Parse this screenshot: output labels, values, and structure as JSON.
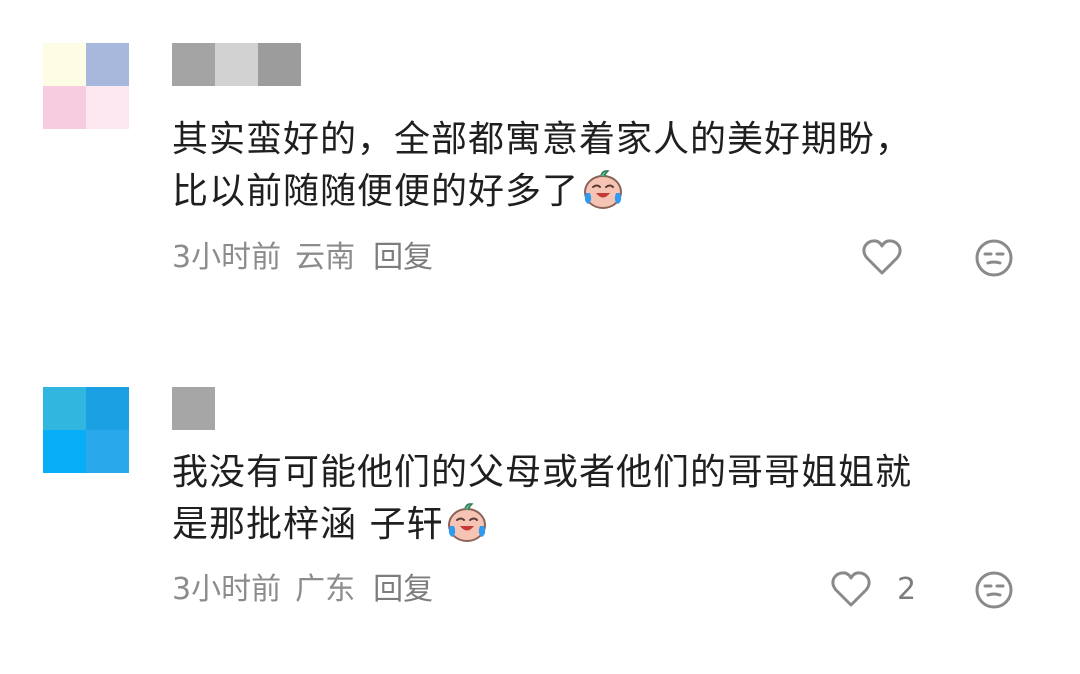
{
  "comments": [
    {
      "text_line1": "其实蛮好的，全部都寓意着家人的美好期盼，",
      "text_line2": "比以前随随便便的好多了",
      "emoji": "crying-laughing-emoji",
      "time": "3小时前",
      "location": "云南",
      "reply_label": "回复",
      "like_count": "",
      "avatar_colors": [
        "#fdfde6",
        "#a8b8dc",
        "#f8cce0",
        "#fde8f2"
      ],
      "username_blocks": [
        "#a4a4a4",
        "#d2d2d2",
        "#9c9c9c"
      ]
    },
    {
      "text_line1": "我没有可能他们的父母或者他们的哥哥姐姐就",
      "text_line2": "是那批梓涵 子轩",
      "emoji": "crying-laughing-emoji",
      "time": "3小时前",
      "location": "广东",
      "reply_label": "回复",
      "like_count": "2",
      "avatar_colors": [
        "#31b7df",
        "#1ba0e3",
        "#08adf7",
        "#2aa8ec"
      ],
      "username_blocks": [
        "#a6a6a6"
      ]
    }
  ],
  "icons": {
    "like": "heart-outline-icon",
    "dislike": "neutral-face-icon"
  }
}
